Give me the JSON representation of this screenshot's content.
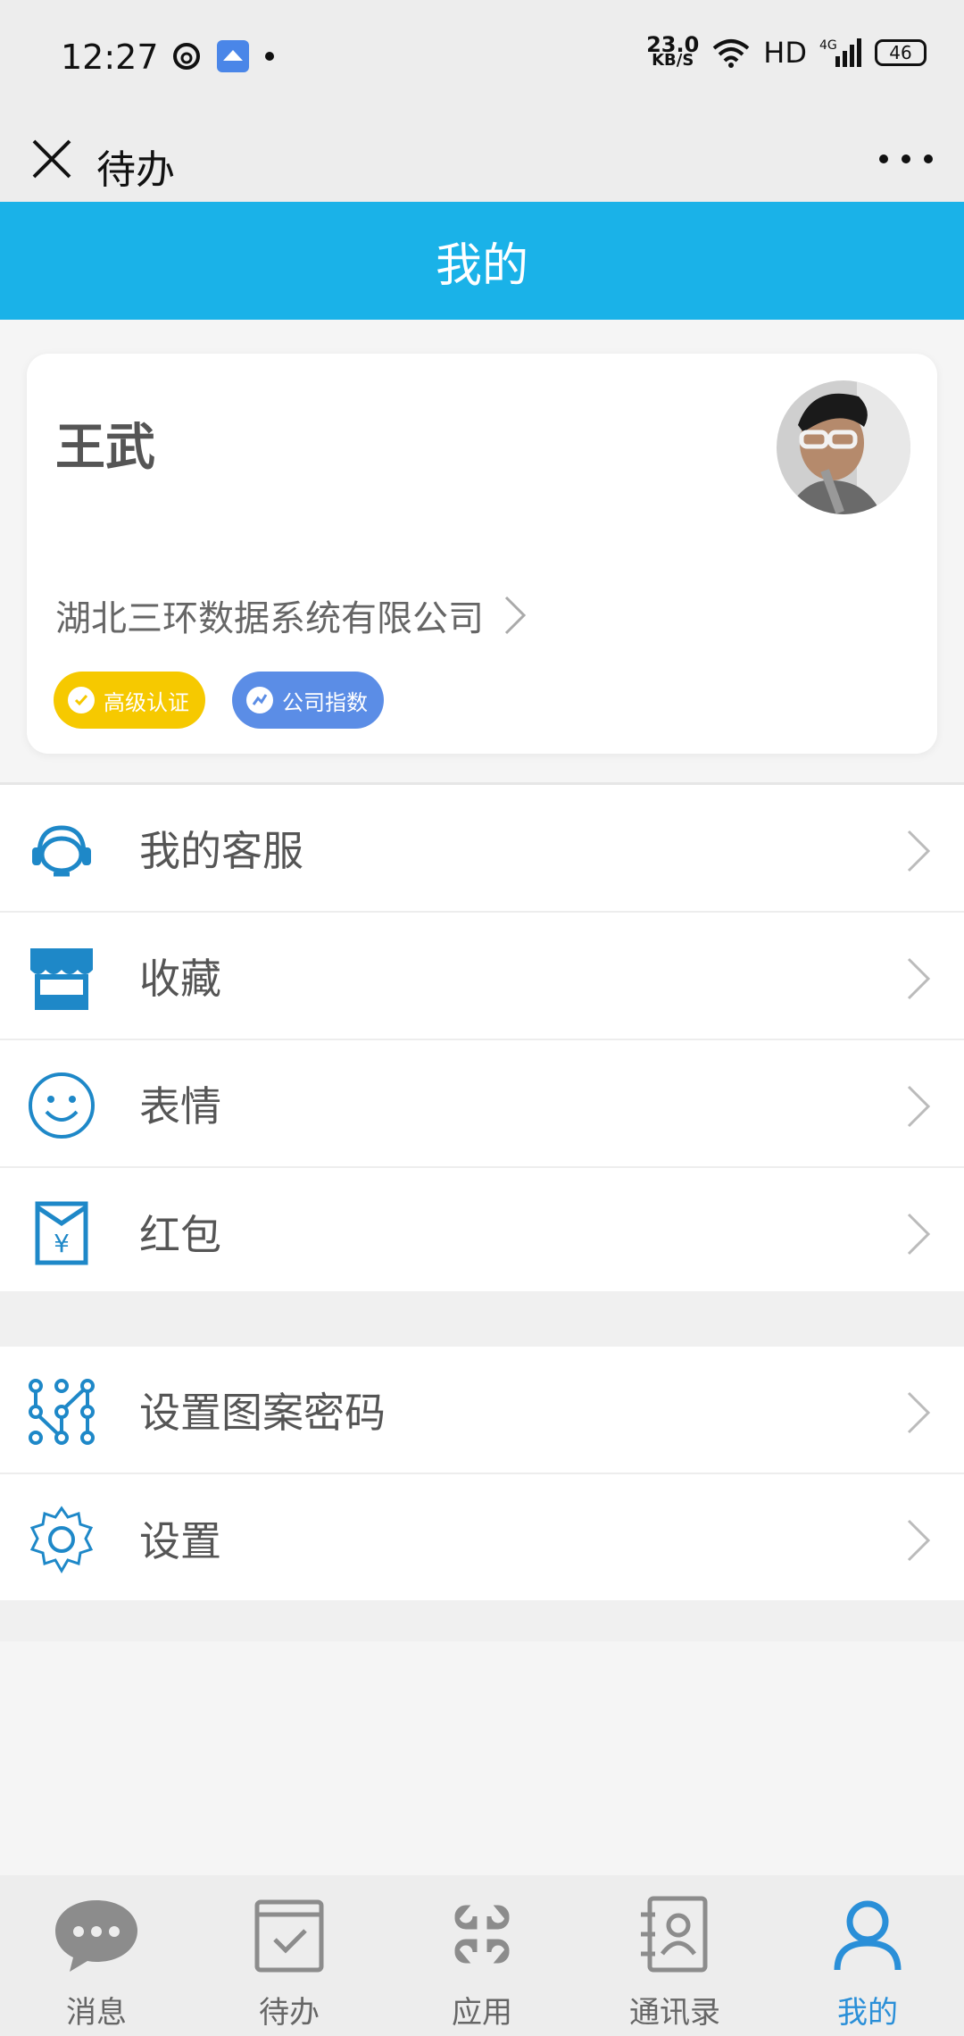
{
  "status_bar": {
    "time": "12:27",
    "speed_value": "23.0",
    "speed_unit": "KB/S",
    "hd": "HD",
    "network": "4G",
    "battery": "46"
  },
  "nav": {
    "title": "待办"
  },
  "header": {
    "title": "我的"
  },
  "profile": {
    "name": "王武",
    "company": "湖北三环数据系统有限公司",
    "badges": [
      {
        "label": "高级认证",
        "color": "#f6c900"
      },
      {
        "label": "公司指数",
        "color": "#5b8de6"
      }
    ]
  },
  "menu": {
    "group1": [
      {
        "label": "我的客服",
        "icon": "headset-icon"
      },
      {
        "label": "收藏",
        "icon": "store-icon"
      },
      {
        "label": "表情",
        "icon": "smiley-icon"
      },
      {
        "label": "红包",
        "icon": "red-envelope-icon"
      }
    ],
    "group2": [
      {
        "label": "设置图案密码",
        "icon": "pattern-lock-icon"
      },
      {
        "label": "设置",
        "icon": "gear-icon"
      }
    ]
  },
  "tabs": [
    {
      "label": "消息",
      "icon": "chat-bubble-icon",
      "active": false
    },
    {
      "label": "待办",
      "icon": "todo-check-icon",
      "active": false
    },
    {
      "label": "应用",
      "icon": "apps-grid-icon",
      "active": false
    },
    {
      "label": "通讯录",
      "icon": "contacts-book-icon",
      "active": false
    },
    {
      "label": "我的",
      "icon": "person-icon",
      "active": true
    }
  ],
  "colors": {
    "accent": "#1ab2e8",
    "icon_blue": "#1e88c8",
    "active_tab": "#2a8fd8"
  }
}
